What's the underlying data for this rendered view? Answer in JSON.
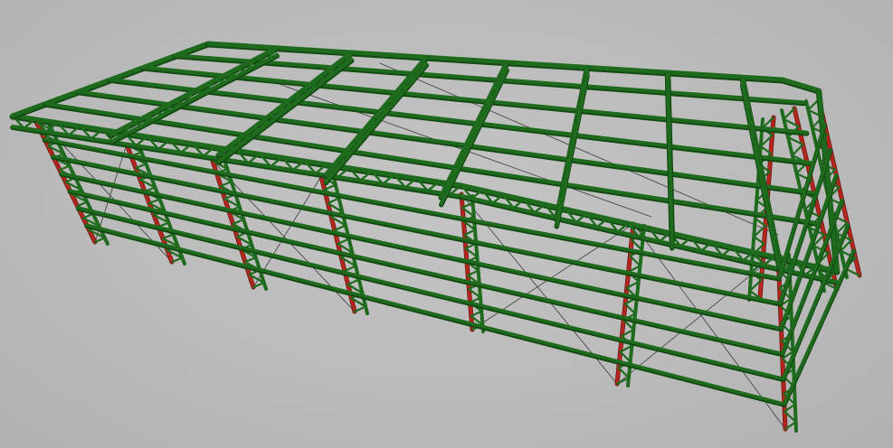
{
  "viewport": {
    "background": "#bdbdbd"
  },
  "model": {
    "colors": {
      "beam": "#1e6b1e",
      "beam_dark": "#134a13",
      "column": "#b3261e",
      "column_dark": "#6e1410",
      "bracing": "#3a3a3a"
    }
  }
}
